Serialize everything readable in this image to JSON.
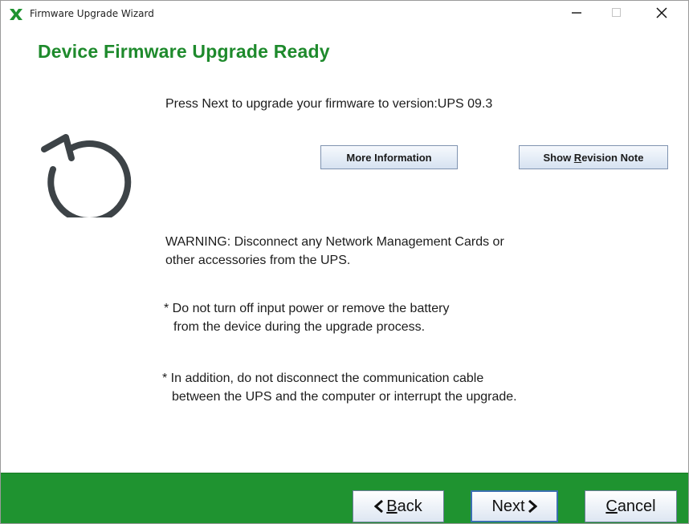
{
  "window": {
    "title": "Firmware Upgrade Wizard",
    "icon": "green-x-app-icon",
    "minimize_icon": "minimize-icon",
    "maximize_icon": "maximize-icon",
    "close_icon": "close-icon"
  },
  "header": {
    "title": "Device Firmware Upgrade Ready"
  },
  "graphic": {
    "icon": "refresh-icon"
  },
  "content": {
    "prompt": "Press Next to upgrade your firmware to version:UPS 09.3",
    "more_info_label": "More Information",
    "revision_label_prefix": "Show ",
    "revision_label_accel": "R",
    "revision_label_suffix": "evision Note",
    "warning_line1": "WARNING: Disconnect any Network  Management Cards or",
    "warning_line2": "other accessories  from the UPS.",
    "note1_line1": "* Do not turn off input power or remove the battery",
    "note1_line2": "from the device during the upgrade process.",
    "note2_line1": "* In addition, do not disconnect the communication cable",
    "note2_line2": "between the UPS and the computer or interrupt the upgrade."
  },
  "footer": {
    "back_accel": "B",
    "back_suffix": "ack",
    "next_label": "Next",
    "cancel_accel": "C",
    "cancel_suffix": "ancel"
  },
  "colors": {
    "accent_green": "#1f9330",
    "title_green": "#1e8a2c",
    "graphic_gray": "#3d4347"
  }
}
